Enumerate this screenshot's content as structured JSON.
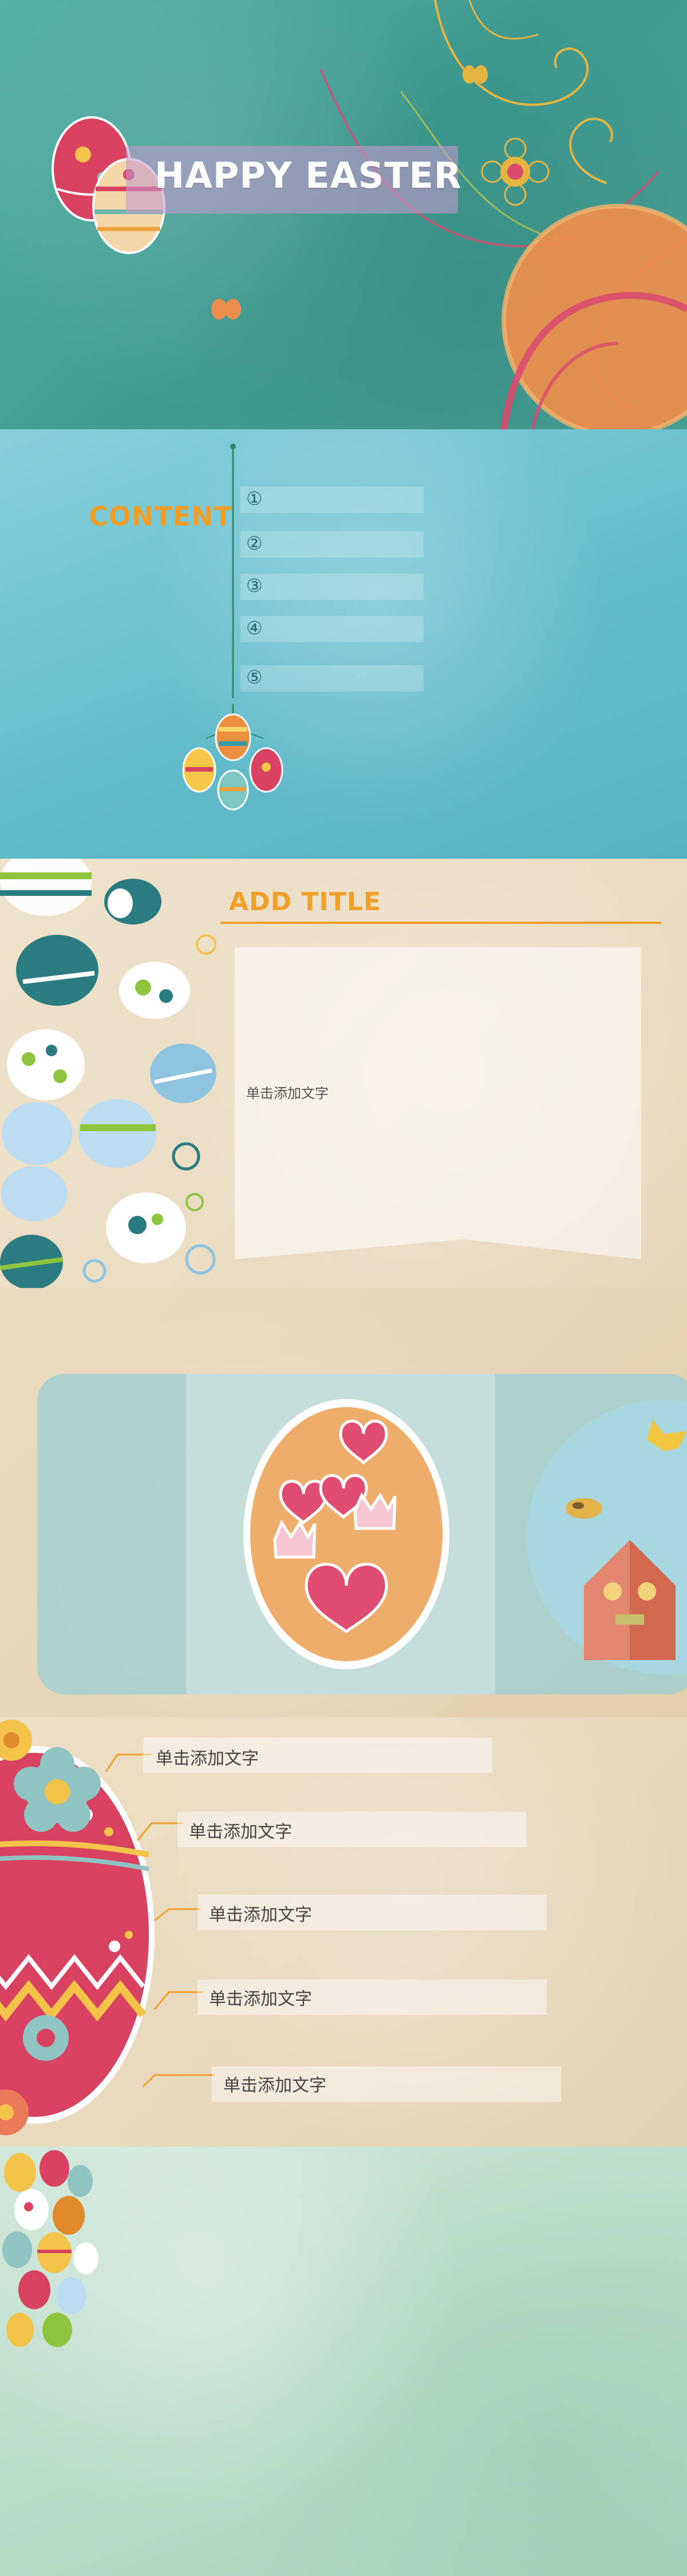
{
  "slide1": {
    "title": "HAPPY EASTER"
  },
  "slide2": {
    "heading": "CONTENT",
    "items": [
      {
        "number": "①"
      },
      {
        "number": "②"
      },
      {
        "number": "③"
      },
      {
        "number": "④"
      },
      {
        "number": "⑤"
      }
    ]
  },
  "slide3": {
    "heading": "ADD TITLE",
    "body": "单击添加文字"
  },
  "slide5": {
    "items": [
      "单击添加文字",
      "单击添加文字",
      "单击添加文字",
      "单击添加文字",
      "单击添加文字"
    ]
  },
  "colors": {
    "accent": "#f0a02a",
    "teal": "#4aa095",
    "sky": "#63bccb",
    "cream": "#efe3cd",
    "pink": "#d83c66"
  }
}
